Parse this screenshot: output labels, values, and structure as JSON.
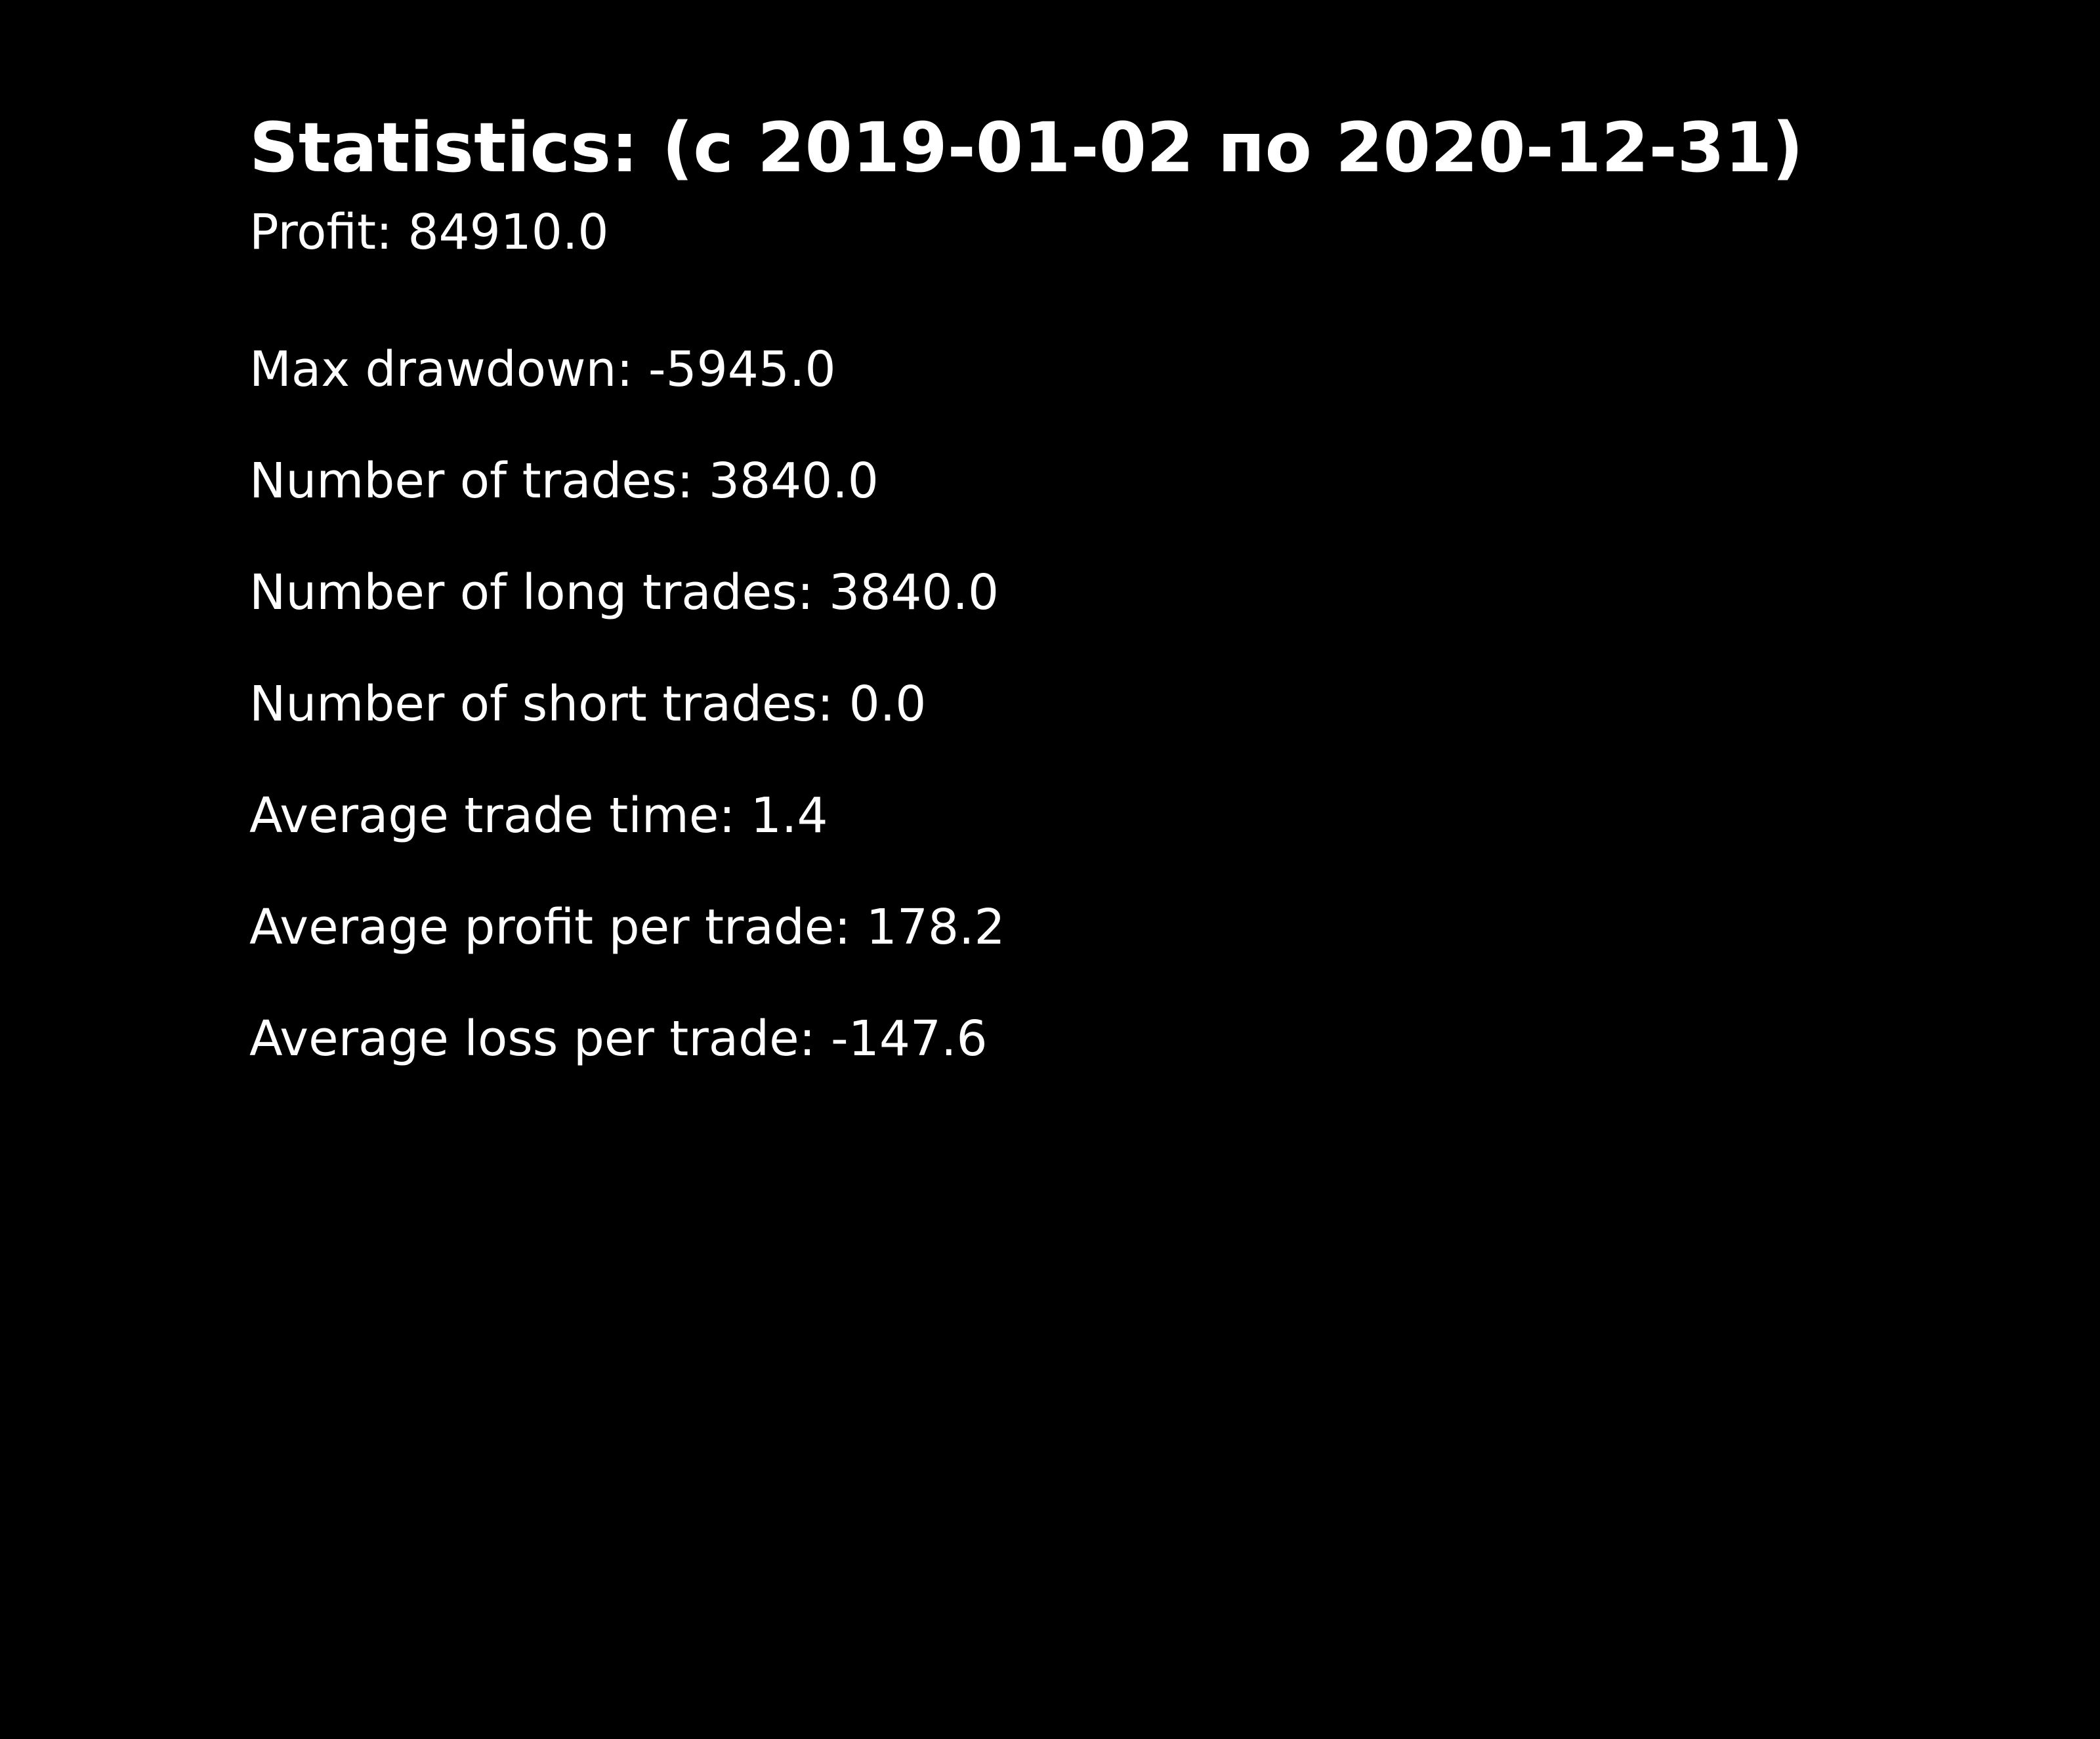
{
  "title": "Statistics: (с 2019-01-02 по 2020-12-31)",
  "stats": [
    "Profit: 84910.0",
    "Max drawdown: -5945.0",
    "Number of trades: 3840.0",
    "Number of long trades: 3840.0",
    "Number of short trades: 0.0",
    "Average trade time: 1.4",
    "Average profit per trade: 178.2",
    "Average loss per trade: -147.6"
  ],
  "colors": {
    "background": "#000000",
    "text": "#ffffff"
  }
}
